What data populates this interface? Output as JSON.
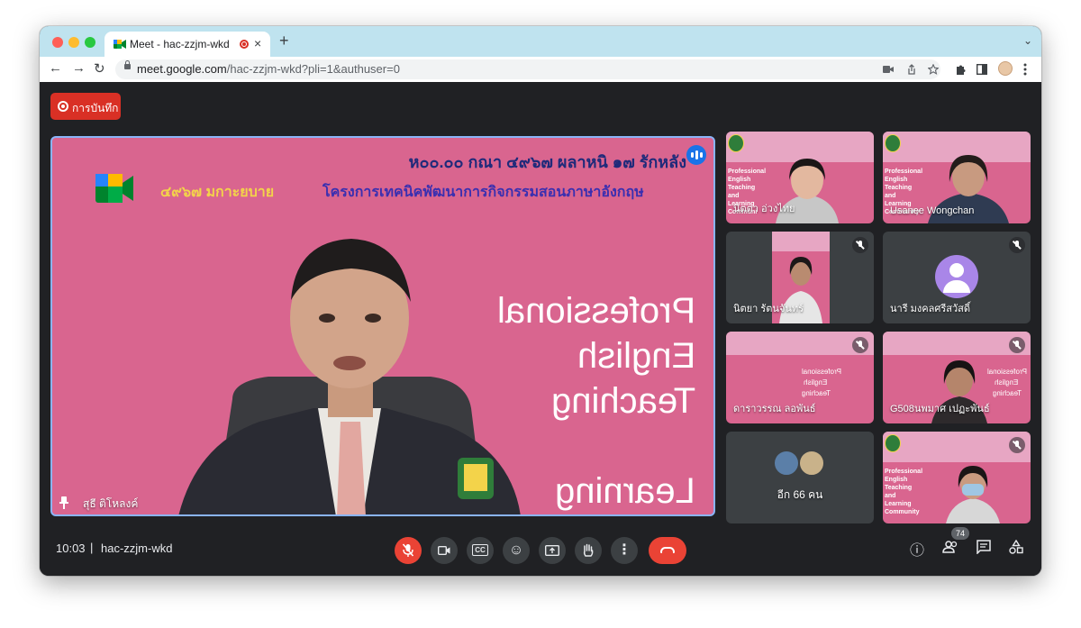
{
  "browser": {
    "tab_title": "Meet - hac-zzjm-wkd",
    "tab_close": "×",
    "new_tab": "+",
    "tab_menu": "⌄",
    "url_host": "meet.google.com",
    "url_path": "/hac-zzjm-wkd?pli=1&authuser=0",
    "nav": {
      "back": "←",
      "forward": "→",
      "reload": "↻"
    },
    "icons": [
      "camera-icon",
      "share-icon",
      "star-icon",
      "extensions-icon",
      "sidepanel-icon",
      "profile-avatar",
      "menu-icon"
    ]
  },
  "meeting": {
    "recording_label": "การบันทึก",
    "time": "10:03",
    "separator": "|",
    "code": "hac-zzjm-wkd",
    "participant_count": "74",
    "accent": "#8ab4f8",
    "hangup_color": "#ea4335",
    "slide_color": "#d9658f"
  },
  "main_tile": {
    "name": "สุธี ติโหลงค์",
    "banner_line1": "ห๐๐.๐๐ กณา ๔๙๖๗ ผลาหนิ ๑๗ รักหลัง",
    "banner_line2": "๔๙๖๗ มกาะยบาย",
    "banner_line3": "โครงการเทคนิคพัฒนาการกิจกรรมสอนภาษาอังกฤษ",
    "mirror_1": "Professional",
    "mirror_2": "English",
    "mirror_3": "Teaching",
    "mirror_4": "Learning"
  },
  "participants": [
    {
      "name": "นิตตา อ่วงไทย",
      "type": "slide-cam",
      "muted": false,
      "slide_text": [
        "Professional",
        "English",
        "Teaching",
        "and",
        "Learning",
        "Communi"
      ]
    },
    {
      "name": "Usanee Wongchan",
      "type": "slide-cam",
      "muted": false,
      "slide_text": [
        "Professional",
        "English",
        "Teaching",
        "and",
        "Learning",
        "Community"
      ]
    },
    {
      "name": "นิตยา รัตนจันทร์",
      "type": "camera",
      "muted": true
    },
    {
      "name": "นารี มงคลศรีสวัสดิ์",
      "type": "avatar",
      "muted": true
    },
    {
      "name": "ดาราวรรณ ลอพันธ์",
      "type": "slide-mirror",
      "muted": true
    },
    {
      "name": "G508นพมาศ เปฏะพันธ์",
      "type": "slide-mirror",
      "muted": true
    },
    {
      "name": "อีก 66 คน",
      "type": "others",
      "muted": false
    },
    {
      "name": "",
      "type": "slide-cam",
      "muted": true,
      "slide_text": [
        "Professional",
        "English",
        "Teaching",
        "and",
        "Learning",
        "Community"
      ]
    }
  ],
  "controls": {
    "mic": "mic-off-icon",
    "camera": "camera-icon",
    "captions": "CC",
    "emoji": "☺",
    "present": "present-icon",
    "raise_hand": "hand-icon",
    "more": "⋮",
    "info": "ⓘ",
    "people": "people-icon",
    "chat": "chat-icon",
    "activities": "activities-icon"
  }
}
